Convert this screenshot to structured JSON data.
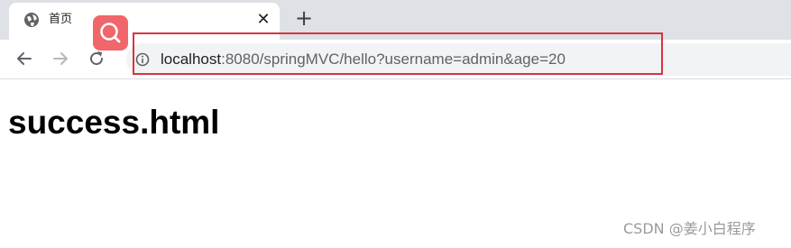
{
  "tab": {
    "title": "首页",
    "favicon_icon": "globe-icon",
    "close_icon": "close-icon"
  },
  "new_tab": {
    "icon": "plus-icon"
  },
  "toolbar": {
    "back_icon": "arrow-left-icon",
    "forward_icon": "arrow-right-icon",
    "reload_icon": "reload-icon"
  },
  "omnibox": {
    "info_icon": "info-icon",
    "url_host": "localhost",
    "url_rest": ":8080/springMVC/hello?username=admin&age=20"
  },
  "overlay": {
    "search_badge_icon": "search-icon",
    "highlight_color": "#d9333f",
    "badge_color": "#f0666a"
  },
  "page": {
    "heading": "success.html"
  },
  "watermark": {
    "text": "CSDN @姜小白程序"
  }
}
